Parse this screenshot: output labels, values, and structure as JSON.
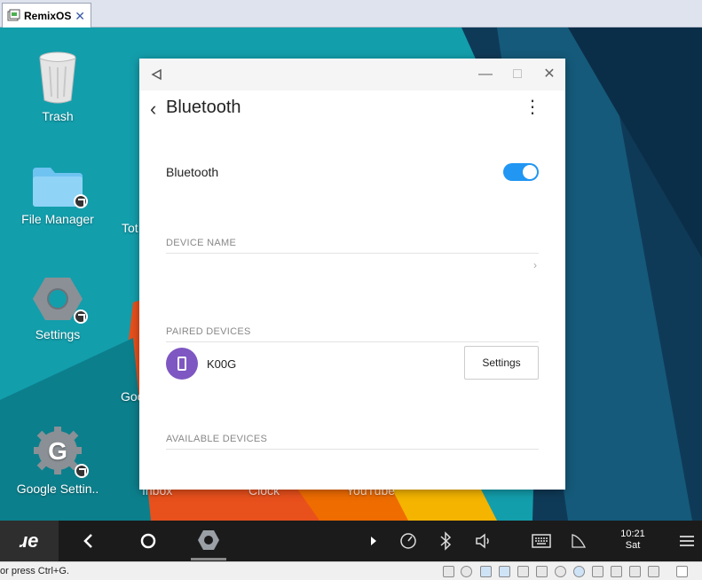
{
  "host_tab": {
    "label": "RemixOS",
    "close": "✕"
  },
  "desktop": {
    "icons": [
      {
        "label": "Trash"
      },
      {
        "label": "File Manager"
      },
      {
        "label": "Settings"
      },
      {
        "label": "Google Settin.."
      }
    ],
    "partial_labels": {
      "tot": "Tot",
      "goo": "Goo",
      "inbox": "Inbox",
      "clock": "Clock",
      "youtube": "YouTube"
    }
  },
  "window": {
    "controls": {
      "minimize": "—",
      "maximize": "□",
      "close": "✕"
    },
    "header": {
      "back": "‹",
      "title": "Bluetooth",
      "more": "⋮"
    },
    "bluetooth_row": {
      "label": "Bluetooth",
      "enabled": true
    },
    "sections": {
      "device_name": "DEVICE NAME",
      "paired_devices": "PAIRED DEVICES",
      "available_devices": "AVAILABLE DEVICES"
    },
    "device_name_chevron": "›",
    "paired": [
      {
        "name": "K00G",
        "button": "Settings"
      }
    ]
  },
  "taskbar": {
    "start_logo": "ɹe",
    "clock": {
      "time": "10:21",
      "day": "Sat"
    }
  },
  "statusbar": {
    "message": "or press Ctrl+G."
  },
  "colors": {
    "desktop_teal": "#139eac",
    "accent_blue": "#2196f3",
    "avatar_purple": "#7e57c2",
    "orange": "#e8501c",
    "dark_navy": "#0f3a57"
  }
}
